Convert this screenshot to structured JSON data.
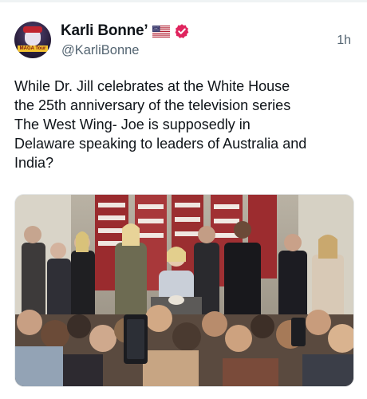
{
  "tweet": {
    "author_name": "Karli Bonne’",
    "handle": "@KarliBonne",
    "timestamp": "1h",
    "text": "While Dr. Jill celebrates at the White House\nthe 25th anniversary of the television series\nThe West Wing- Joe is supposedly in\nDelaware speaking to leaders of Australia and\nIndia?",
    "avatar_text": "MAGA Tour",
    "icons": [
      "us-flag-icon",
      "verified-badge-icon"
    ],
    "colors": {
      "verified": "#e0245e",
      "text": "#0f1419",
      "secondary": "#536471"
    }
  },
  "media": {
    "kind": "photo"
  }
}
